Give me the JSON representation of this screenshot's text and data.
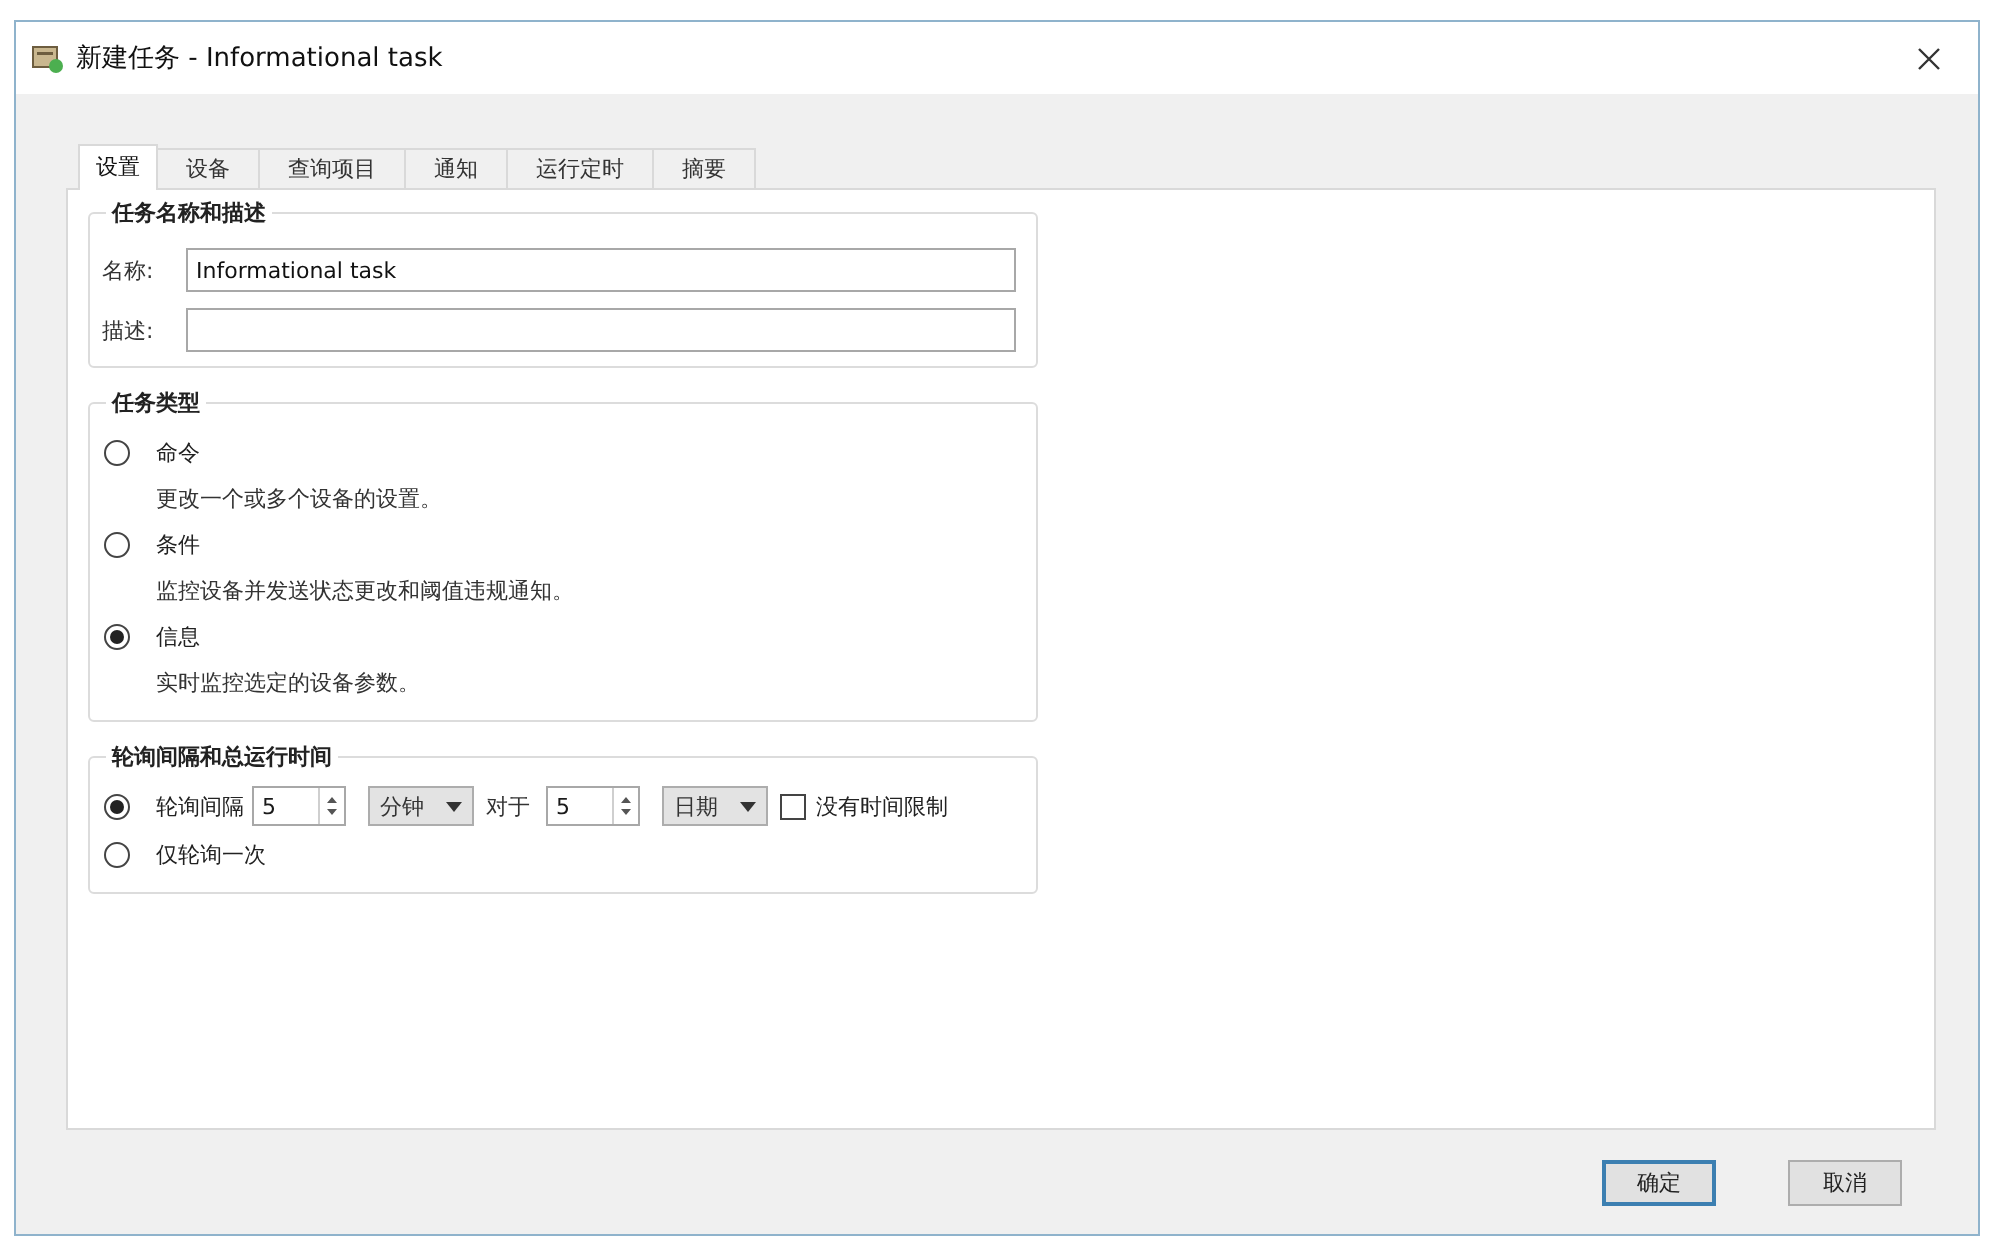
{
  "window": {
    "title": "新建任务 - Informational task"
  },
  "tabs": [
    {
      "label": "设置",
      "selected": true
    },
    {
      "label": "设备",
      "selected": false
    },
    {
      "label": "查询项目",
      "selected": false
    },
    {
      "label": "通知",
      "selected": false
    },
    {
      "label": "运行定时",
      "selected": false
    },
    {
      "label": "摘要",
      "selected": false
    }
  ],
  "name_section": {
    "title": "任务名称和描述",
    "fields": [
      {
        "label": "名称:",
        "value": "Informational task"
      },
      {
        "label": "描述:"
      }
    ]
  },
  "task_type": {
    "title": "任务类型",
    "options": [
      {
        "label": "命令",
        "description": "更改一个或多个设备的设置。",
        "selected": false
      },
      {
        "label": "条件",
        "description": "监控设备并发送状态更改和阈值违规通知。",
        "selected": false
      },
      {
        "label": "信息",
        "description": "实时监控选定的设备参数。",
        "selected": true
      }
    ]
  },
  "polling": {
    "title": "轮询间隔和总运行时间",
    "options": [
      {
        "kind": "interval",
        "label": "轮询间隔",
        "selected": true,
        "interval": "5",
        "interval_unit": "分钟",
        "for_label": "对于",
        "duration": "5",
        "duration_unit": "日期",
        "no_limit": {
          "label": "没有时间限制",
          "checked": false
        }
      },
      {
        "kind": "once",
        "label": "仅轮询一次",
        "selected": false
      }
    ]
  },
  "buttons": [
    {
      "label": "确定",
      "default": true
    },
    {
      "label": "取消",
      "default": false
    }
  ]
}
